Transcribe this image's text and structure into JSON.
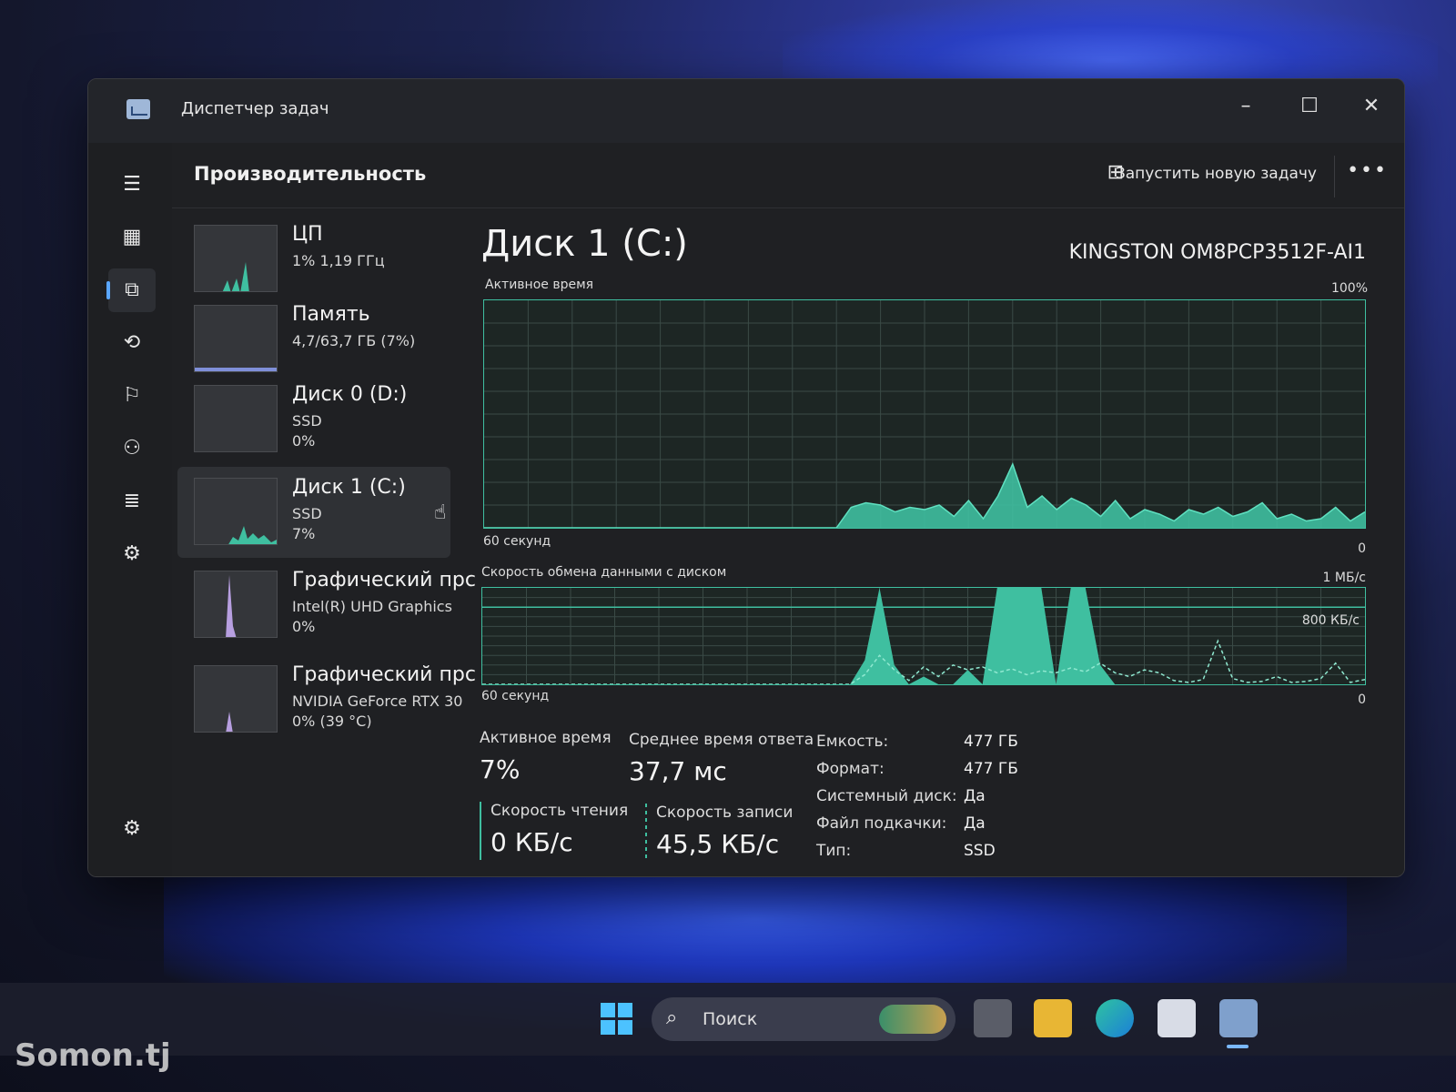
{
  "window": {
    "title": "Диспетчер задач",
    "minimize": "–",
    "maximize": "☐",
    "close": "✕"
  },
  "header": {
    "title": "Производительность",
    "run_task_label": "Запустить новую задачу",
    "run_task_icon": "new-task-icon",
    "more": "•••"
  },
  "nav": {
    "items": [
      {
        "icon": "hamburger-menu-icon",
        "glyph": "☰"
      },
      {
        "icon": "processes-icon",
        "glyph": "▦"
      },
      {
        "icon": "performance-icon",
        "glyph": "⧉",
        "active": true
      },
      {
        "icon": "app-history-icon",
        "glyph": "⟲"
      },
      {
        "icon": "startup-apps-icon",
        "glyph": "⚐"
      },
      {
        "icon": "users-icon",
        "glyph": "⚇"
      },
      {
        "icon": "details-icon",
        "glyph": "≣"
      },
      {
        "icon": "services-icon",
        "glyph": "⚙"
      }
    ],
    "settings_glyph": "⚙"
  },
  "devices": [
    {
      "name": "ЦП",
      "sub1": "1% 1,19 ГГц",
      "sub2": ""
    },
    {
      "name": "Память",
      "sub1": "4,7/63,7 ГБ (7%)",
      "sub2": ""
    },
    {
      "name": "Диск 0 (D:)",
      "sub1": "SSD",
      "sub2": "0%"
    },
    {
      "name": "Диск 1 (C:)",
      "sub1": "SSD",
      "sub2": "7%",
      "selected": true
    },
    {
      "name": "Графический прс",
      "sub1": "Intel(R) UHD Graphics",
      "sub2": "0%"
    },
    {
      "name": "Графический прс",
      "sub1": "NVIDIA GeForce RTX 30",
      "sub2": "0% (39 °C)"
    }
  ],
  "main": {
    "title": "Диск 1 (C:)",
    "model": "KINGSTON OM8PCP3512F-AI1",
    "active_chart": {
      "label": "Активное время",
      "max": "100%",
      "duration": "60 секунд",
      "min": "0"
    },
    "transfer_chart": {
      "label": "Скорость обмена данными с диском",
      "max": "1 МБ/с",
      "mid": "800 КБ/с",
      "duration": "60 секунд",
      "min": "0"
    },
    "stats": {
      "active_time_label": "Активное время",
      "active_time_value": "7%",
      "response_label": "Среднее время ответа",
      "response_value": "37,7 мс",
      "read_label": "Скорость чтения",
      "read_value": "0 КБ/с",
      "write_label": "Скорость записи",
      "write_value": "45,5 КБ/с"
    },
    "properties": [
      {
        "key": "Емкость:",
        "value": "477 ГБ"
      },
      {
        "key": "Формат:",
        "value": "477 ГБ"
      },
      {
        "key": "Системный диск:",
        "value": "Да"
      },
      {
        "key": "Файл подкачки:",
        "value": "Да"
      },
      {
        "key": "Тип:",
        "value": "SSD"
      }
    ]
  },
  "chart_data": [
    {
      "type": "area",
      "title": "Активное время",
      "ylim": [
        0,
        100
      ],
      "xlabel": "60 секунд",
      "values": [
        0,
        0,
        0,
        0,
        0,
        0,
        0,
        0,
        0,
        0,
        0,
        0,
        0,
        0,
        0,
        0,
        0,
        0,
        0,
        0,
        0,
        0,
        0,
        0,
        0,
        9,
        11,
        10,
        7,
        9,
        8,
        10,
        5,
        12,
        4,
        14,
        28,
        9,
        14,
        8,
        13,
        10,
        5,
        12,
        4,
        8,
        6,
        3,
        8,
        6,
        9,
        5,
        7,
        11,
        4,
        6,
        3,
        4,
        9,
        3,
        7
      ]
    },
    {
      "type": "area",
      "title": "Скорость обмена данными с диском",
      "ylim": [
        0,
        1000
      ],
      "series": [
        {
          "values": [
            0,
            0,
            0,
            0,
            0,
            0,
            0,
            0,
            0,
            0,
            0,
            0,
            0,
            0,
            0,
            0,
            0,
            0,
            0,
            0,
            0,
            0,
            0,
            0,
            0,
            0,
            250,
            1000,
            200,
            0,
            80,
            0,
            0,
            150,
            0,
            1000,
            1000,
            1000,
            1000,
            0,
            1000,
            1000,
            200,
            0,
            0,
            0,
            0,
            0,
            0,
            0,
            0,
            0,
            0,
            0,
            0,
            0,
            0,
            0,
            0,
            0,
            0
          ]
        },
        {
          "values": [
            0,
            0,
            0,
            0,
            0,
            0,
            0,
            0,
            0,
            0,
            0,
            0,
            0,
            0,
            0,
            0,
            0,
            0,
            0,
            0,
            0,
            0,
            0,
            0,
            0,
            0,
            100,
            300,
            150,
            40,
            180,
            80,
            200,
            150,
            180,
            120,
            160,
            100,
            140,
            120,
            170,
            130,
            220,
            120,
            80,
            150,
            120,
            40,
            20,
            50,
            450,
            60,
            20,
            30,
            80,
            20,
            30,
            60,
            220,
            20,
            50
          ]
        }
      ]
    }
  ],
  "taskbar": {
    "search_placeholder": "Поиск",
    "search_icon": "search-icon"
  },
  "watermark": "Somon.tj"
}
